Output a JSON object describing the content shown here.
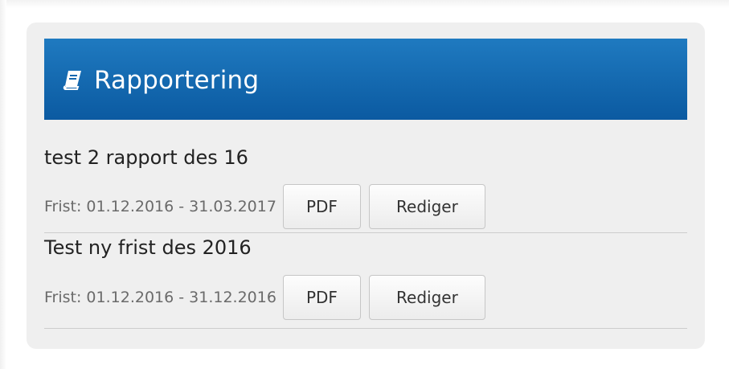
{
  "panel": {
    "title": "Rapportering",
    "icon": "book-icon"
  },
  "reports": [
    {
      "title": "test 2 rapport des 16",
      "deadline": "Frist: 01.12.2016 - 31.03.2017",
      "pdf_label": "PDF",
      "edit_label": "Rediger"
    },
    {
      "title": "Test ny frist des 2016",
      "deadline": "Frist: 01.12.2016 - 31.12.2016",
      "pdf_label": "PDF",
      "edit_label": "Rediger"
    }
  ],
  "colors": {
    "header_top": "#1f7ac0",
    "header_bottom": "#0b5aa1",
    "panel_bg": "#efefef"
  }
}
